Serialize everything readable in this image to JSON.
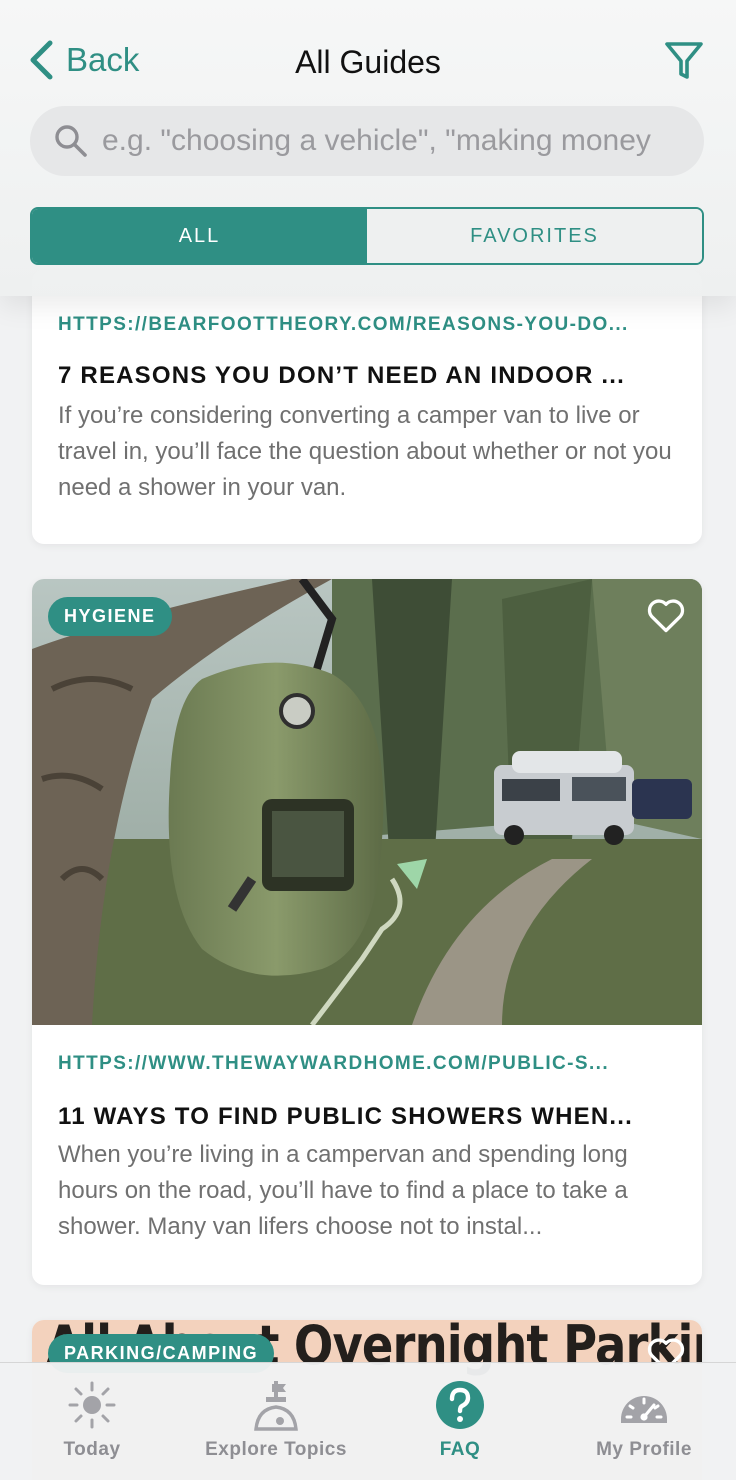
{
  "header": {
    "back_label": "Back",
    "title": "All Guides",
    "search_placeholder": "e.g. \"choosing a vehicle\", \"making money",
    "segments": {
      "all": "ALL",
      "favorites": "FAVORITES"
    }
  },
  "guides": [
    {
      "url": "HTTPS://BEARFOOTTHEORY.COM/REASONS-YOU-DO...",
      "title": "7 REASONS YOU DON’T NEED AN INDOOR ...",
      "description": "If you’re considering converting a camper van to live or travel in, you’ll face the question about whether or not you need a shower in your van."
    },
    {
      "category": "HYGIENE",
      "url": "HTTPS://WWW.THEWAYWARDHOME.COM/PUBLIC-S...",
      "title": "11 WAYS TO FIND PUBLIC SHOWERS WHEN...",
      "description": "When you’re living in a campervan and spending long hours on the road, you’ll have to find a place to take a shower. Many van lifers choose not to instal..."
    },
    {
      "category": "PARKING/CAMPING",
      "image_caption": "All About Overnight Parking"
    }
  ],
  "tabbar": [
    {
      "label": "Today",
      "icon": "sun-icon"
    },
    {
      "label": "Explore Topics",
      "icon": "explore-icon"
    },
    {
      "label": "FAQ",
      "icon": "question-icon"
    },
    {
      "label": "My Profile",
      "icon": "gauge-icon"
    }
  ],
  "colors": {
    "accent": "#2f8f84",
    "inactive": "#8e8e93"
  }
}
